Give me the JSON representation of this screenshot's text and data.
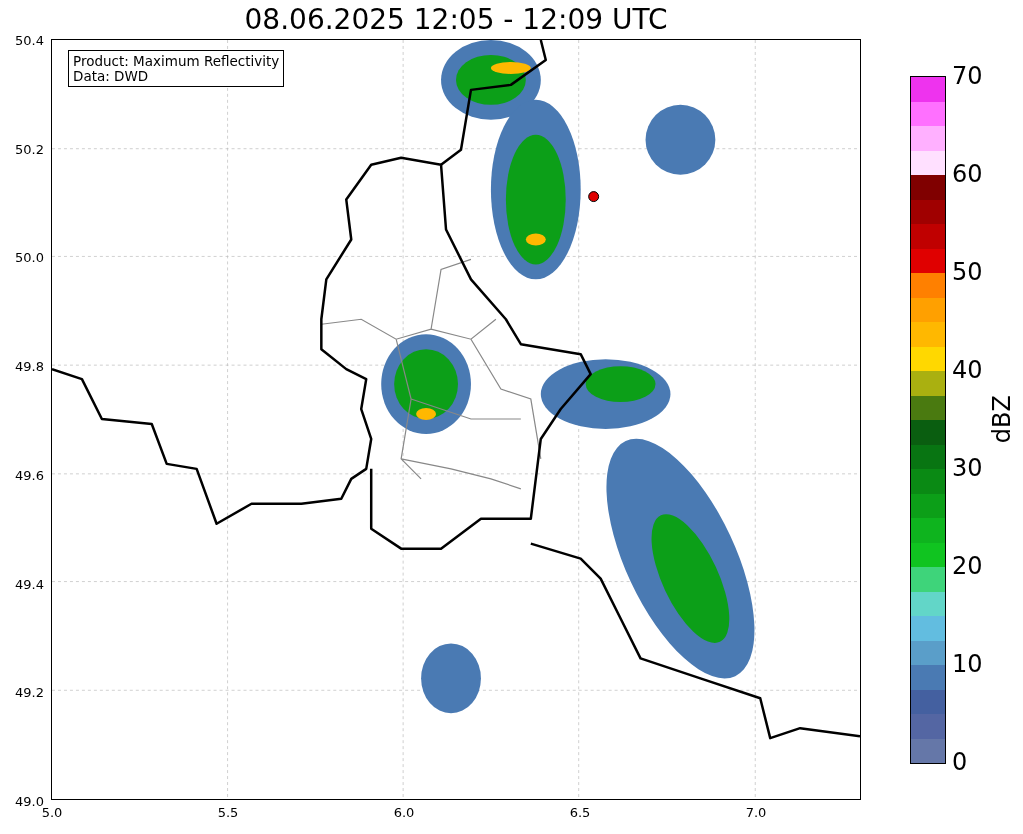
{
  "title": "08.06.2025 12:05 - 12:09 UTC",
  "legend": {
    "product": "Product: Maximum Reflectivity",
    "data": "Data: DWD"
  },
  "x_axis": {
    "ticks": [
      "5.0",
      "5.5",
      "6.0",
      "6.5",
      "7.0"
    ]
  },
  "y_axis": {
    "ticks": [
      "50.4",
      "50.2",
      "50.0",
      "49.8",
      "49.6",
      "49.4",
      "49.2",
      "49.0"
    ]
  },
  "colorbar": {
    "label": "dBZ",
    "ticks": [
      "70",
      "60",
      "50",
      "40",
      "30",
      "20",
      "10",
      "0"
    ],
    "segments": [
      {
        "color": "#6577a8"
      },
      {
        "color": "#5466a3"
      },
      {
        "color": "#4460a0"
      },
      {
        "color": "#4a7ab3"
      },
      {
        "color": "#5a9ec9"
      },
      {
        "color": "#62bde0"
      },
      {
        "color": "#62d6c8"
      },
      {
        "color": "#3ed47a"
      },
      {
        "color": "#10c420"
      },
      {
        "color": "#0eb41e"
      },
      {
        "color": "#0c9f18"
      },
      {
        "color": "#0a8a14"
      },
      {
        "color": "#087512"
      },
      {
        "color": "#0a5e10"
      },
      {
        "color": "#4a7a10"
      },
      {
        "color": "#aab010"
      },
      {
        "color": "#ffd800"
      },
      {
        "color": "#ffb800"
      },
      {
        "color": "#ffa000"
      },
      {
        "color": "#ff8000"
      },
      {
        "color": "#e00000"
      },
      {
        "color": "#c00000"
      },
      {
        "color": "#a00000"
      },
      {
        "color": "#800000"
      },
      {
        "color": "#ffe0ff"
      },
      {
        "color": "#ffb0ff"
      },
      {
        "color": "#ff70ff"
      },
      {
        "color": "#ee33ee"
      }
    ]
  }
}
